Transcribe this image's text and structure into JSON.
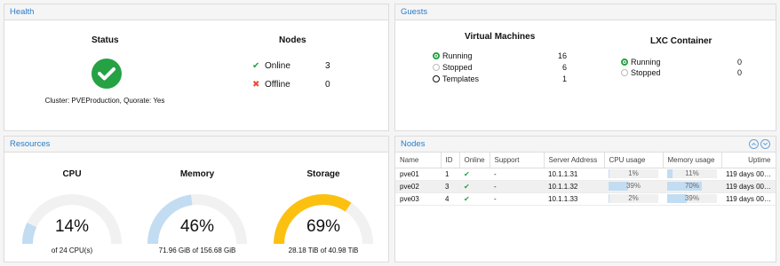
{
  "health": {
    "title": "Health",
    "status_label": "Status",
    "nodes_label": "Nodes",
    "cluster_text": "Cluster: PVEProduction, Quorate: Yes",
    "online_label": "Online",
    "online_count": "3",
    "offline_label": "Offline",
    "offline_count": "0"
  },
  "guests": {
    "title": "Guests",
    "vm_title": "Virtual Machines",
    "lxc_title": "LXC Container",
    "vm": {
      "running_label": "Running",
      "running": "16",
      "stopped_label": "Stopped",
      "stopped": "6",
      "templates_label": "Templates",
      "templates": "1"
    },
    "lxc": {
      "running_label": "Running",
      "running": "0",
      "stopped_label": "Stopped",
      "stopped": "0"
    }
  },
  "resources": {
    "title": "Resources",
    "gauges": [
      {
        "name": "CPU",
        "percent_text": "14%",
        "value": 0.14,
        "sub": "of 24 CPU(s)",
        "color": "#c2dcf2"
      },
      {
        "name": "Memory",
        "percent_text": "46%",
        "value": 0.46,
        "sub": "71.96 GiB of 156.68 GiB",
        "color": "#c2dcf2"
      },
      {
        "name": "Storage",
        "percent_text": "69%",
        "value": 0.69,
        "sub": "28.18 TiB of 40.98 TiB",
        "color": "#fcc010"
      }
    ]
  },
  "nodes": {
    "title": "Nodes",
    "columns": [
      "Name",
      "ID",
      "Online",
      "Support",
      "Server Address",
      "CPU usage",
      "Memory usage",
      "Uptime"
    ],
    "rows": [
      {
        "name": "pve01",
        "id": "1",
        "support": "-",
        "address": "10.1.1.31",
        "cpu_text": "1%",
        "cpu": 0.01,
        "mem_text": "11%",
        "mem": 0.11,
        "uptime": "119 days 00:..."
      },
      {
        "name": "pve02",
        "id": "3",
        "support": "-",
        "address": "10.1.1.32",
        "cpu_text": "39%",
        "cpu": 0.39,
        "mem_text": "70%",
        "mem": 0.7,
        "uptime": "119 days 00:..."
      },
      {
        "name": "pve03",
        "id": "4",
        "support": "-",
        "address": "10.1.1.33",
        "cpu_text": "2%",
        "cpu": 0.02,
        "mem_text": "39%",
        "mem": 0.39,
        "uptime": "119 days 00:..."
      }
    ]
  },
  "colors": {
    "accent": "#2a7ccb",
    "ok": "#25a244",
    "error": "#e74c3c",
    "gauge_track": "#f1f1f1"
  }
}
